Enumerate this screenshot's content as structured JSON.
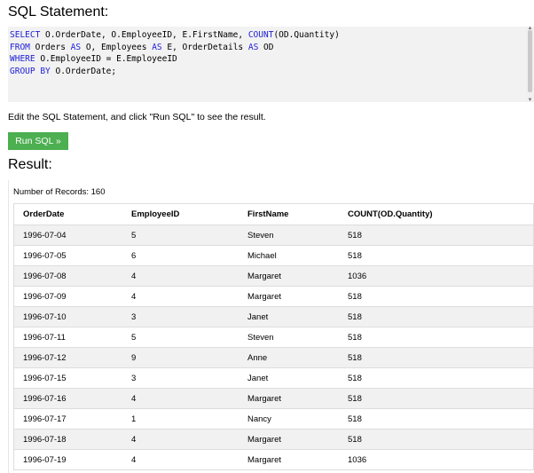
{
  "sql_section": {
    "title": "SQL Statement:",
    "query_lines": [
      "SELECT O.OrderDate, O.EmployeeID, E.FirstName, COUNT(OD.Quantity)",
      "FROM Orders AS O, Employees AS E, OrderDetails AS OD",
      "WHERE O.EmployeeID = E.EmployeeID",
      "GROUP BY O.OrderDate;"
    ]
  },
  "instructions": "Edit the SQL Statement, and click \"Run SQL\" to see the result.",
  "run_button": {
    "label": "Run SQL »",
    "color": "#4caf50"
  },
  "result_section": {
    "title": "Result:",
    "record_count": "Number of Records: 160"
  },
  "table": {
    "headers": [
      "OrderDate",
      "EmployeeID",
      "FirstName",
      "COUNT(OD.Quantity)"
    ],
    "rows": [
      [
        "1996-07-04",
        "5",
        "Steven",
        "518"
      ],
      [
        "1996-07-05",
        "6",
        "Michael",
        "518"
      ],
      [
        "1996-07-08",
        "4",
        "Margaret",
        "1036"
      ],
      [
        "1996-07-09",
        "4",
        "Margaret",
        "518"
      ],
      [
        "1996-07-10",
        "3",
        "Janet",
        "518"
      ],
      [
        "1996-07-11",
        "5",
        "Steven",
        "518"
      ],
      [
        "1996-07-12",
        "9",
        "Anne",
        "518"
      ],
      [
        "1996-07-15",
        "3",
        "Janet",
        "518"
      ],
      [
        "1996-07-16",
        "4",
        "Margaret",
        "518"
      ],
      [
        "1996-07-17",
        "1",
        "Nancy",
        "518"
      ],
      [
        "1996-07-18",
        "4",
        "Margaret",
        "518"
      ],
      [
        "1996-07-19",
        "4",
        "Margaret",
        "1036"
      ]
    ]
  }
}
